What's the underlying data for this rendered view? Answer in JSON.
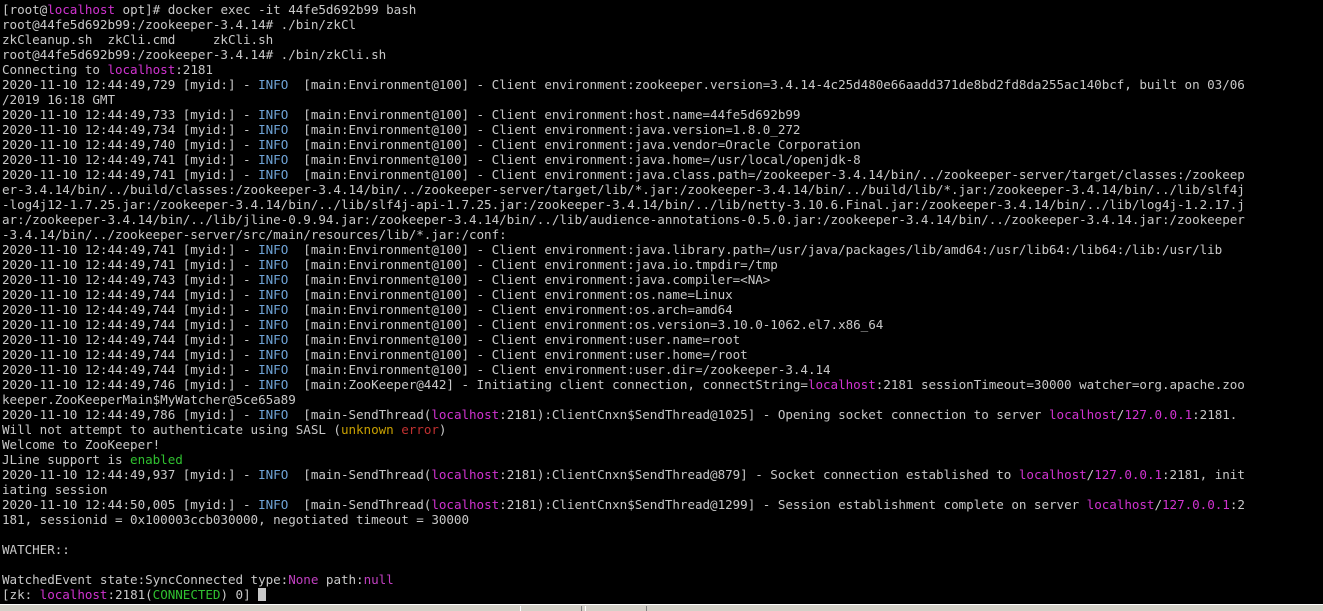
{
  "terminal": {
    "cursor_visible": true,
    "colors": {
      "background": "#000000",
      "text": "#c8c8c8",
      "info": "#6fa3d6",
      "host": "#d033d0",
      "ip": "#d033d0",
      "state": "#c040c0",
      "unknown": "#c8a000",
      "error": "#c03030",
      "ok": "#30c030"
    },
    "lines": [
      [
        {
          "t": "[root@",
          "c": "plain"
        },
        {
          "t": "localhost",
          "c": "host"
        },
        {
          "t": " opt]# docker exec -it 44fe5d692b99 bash",
          "c": "plain"
        }
      ],
      [
        {
          "t": "root@44fe5d692b99:/zookeeper-3.4.14# ./bin/zkCl",
          "c": "plain"
        }
      ],
      [
        {
          "t": "zkCleanup.sh  zkCli.cmd     zkCli.sh",
          "c": "plain"
        }
      ],
      [
        {
          "t": "root@44fe5d692b99:/zookeeper-3.4.14# ./bin/zkCli.sh",
          "c": "plain"
        }
      ],
      [
        {
          "t": "Connecting to ",
          "c": "plain"
        },
        {
          "t": "localhost",
          "c": "host"
        },
        {
          "t": ":2181",
          "c": "plain"
        }
      ],
      [
        {
          "t": "2020-11-10 12:44:49,729 [myid:] - ",
          "c": "plain"
        },
        {
          "t": "INFO",
          "c": "info"
        },
        {
          "t": "  [main:Environment@100] - Client environment:zookeeper.version=3.4.14-4c25d480e66aadd371de8bd2fd8da255ac140bcf, built on 03/06",
          "c": "plain"
        }
      ],
      [
        {
          "t": "/2019 16:18 GMT",
          "c": "plain"
        }
      ],
      [
        {
          "t": "2020-11-10 12:44:49,733 [myid:] - ",
          "c": "plain"
        },
        {
          "t": "INFO",
          "c": "info"
        },
        {
          "t": "  [main:Environment@100] - Client environment:host.name=44fe5d692b99",
          "c": "plain"
        }
      ],
      [
        {
          "t": "2020-11-10 12:44:49,734 [myid:] - ",
          "c": "plain"
        },
        {
          "t": "INFO",
          "c": "info"
        },
        {
          "t": "  [main:Environment@100] - Client environment:java.version=1.8.0_272",
          "c": "plain"
        }
      ],
      [
        {
          "t": "2020-11-10 12:44:49,740 [myid:] - ",
          "c": "plain"
        },
        {
          "t": "INFO",
          "c": "info"
        },
        {
          "t": "  [main:Environment@100] - Client environment:java.vendor=Oracle Corporation",
          "c": "plain"
        }
      ],
      [
        {
          "t": "2020-11-10 12:44:49,741 [myid:] - ",
          "c": "plain"
        },
        {
          "t": "INFO",
          "c": "info"
        },
        {
          "t": "  [main:Environment@100] - Client environment:java.home=/usr/local/openjdk-8",
          "c": "plain"
        }
      ],
      [
        {
          "t": "2020-11-10 12:44:49,741 [myid:] - ",
          "c": "plain"
        },
        {
          "t": "INFO",
          "c": "info"
        },
        {
          "t": "  [main:Environment@100] - Client environment:java.class.path=/zookeeper-3.4.14/bin/../zookeeper-server/target/classes:/zookeep",
          "c": "plain"
        }
      ],
      [
        {
          "t": "er-3.4.14/bin/../build/classes:/zookeeper-3.4.14/bin/../zookeeper-server/target/lib/*.jar:/zookeeper-3.4.14/bin/../build/lib/*.jar:/zookeeper-3.4.14/bin/../lib/slf4j",
          "c": "plain"
        }
      ],
      [
        {
          "t": "-log4j12-1.7.25.jar:/zookeeper-3.4.14/bin/../lib/slf4j-api-1.7.25.jar:/zookeeper-3.4.14/bin/../lib/netty-3.10.6.Final.jar:/zookeeper-3.4.14/bin/../lib/log4j-1.2.17.j",
          "c": "plain"
        }
      ],
      [
        {
          "t": "ar:/zookeeper-3.4.14/bin/../lib/jline-0.9.94.jar:/zookeeper-3.4.14/bin/../lib/audience-annotations-0.5.0.jar:/zookeeper-3.4.14/bin/../zookeeper-3.4.14.jar:/zookeeper",
          "c": "plain"
        }
      ],
      [
        {
          "t": "-3.4.14/bin/../zookeeper-server/src/main/resources/lib/*.jar:/conf:",
          "c": "plain"
        }
      ],
      [
        {
          "t": "2020-11-10 12:44:49,741 [myid:] - ",
          "c": "plain"
        },
        {
          "t": "INFO",
          "c": "info"
        },
        {
          "t": "  [main:Environment@100] - Client environment:java.library.path=/usr/java/packages/lib/amd64:/usr/lib64:/lib64:/lib:/usr/lib",
          "c": "plain"
        }
      ],
      [
        {
          "t": "2020-11-10 12:44:49,741 [myid:] - ",
          "c": "plain"
        },
        {
          "t": "INFO",
          "c": "info"
        },
        {
          "t": "  [main:Environment@100] - Client environment:java.io.tmpdir=/tmp",
          "c": "plain"
        }
      ],
      [
        {
          "t": "2020-11-10 12:44:49,743 [myid:] - ",
          "c": "plain"
        },
        {
          "t": "INFO",
          "c": "info"
        },
        {
          "t": "  [main:Environment@100] - Client environment:java.compiler=<NA>",
          "c": "plain"
        }
      ],
      [
        {
          "t": "2020-11-10 12:44:49,744 [myid:] - ",
          "c": "plain"
        },
        {
          "t": "INFO",
          "c": "info"
        },
        {
          "t": "  [main:Environment@100] - Client environment:os.name=Linux",
          "c": "plain"
        }
      ],
      [
        {
          "t": "2020-11-10 12:44:49,744 [myid:] - ",
          "c": "plain"
        },
        {
          "t": "INFO",
          "c": "info"
        },
        {
          "t": "  [main:Environment@100] - Client environment:os.arch=amd64",
          "c": "plain"
        }
      ],
      [
        {
          "t": "2020-11-10 12:44:49,744 [myid:] - ",
          "c": "plain"
        },
        {
          "t": "INFO",
          "c": "info"
        },
        {
          "t": "  [main:Environment@100] - Client environment:os.version=3.10.0-1062.el7.x86_64",
          "c": "plain"
        }
      ],
      [
        {
          "t": "2020-11-10 12:44:49,744 [myid:] - ",
          "c": "plain"
        },
        {
          "t": "INFO",
          "c": "info"
        },
        {
          "t": "  [main:Environment@100] - Client environment:user.name=root",
          "c": "plain"
        }
      ],
      [
        {
          "t": "2020-11-10 12:44:49,744 [myid:] - ",
          "c": "plain"
        },
        {
          "t": "INFO",
          "c": "info"
        },
        {
          "t": "  [main:Environment@100] - Client environment:user.home=/root",
          "c": "plain"
        }
      ],
      [
        {
          "t": "2020-11-10 12:44:49,744 [myid:] - ",
          "c": "plain"
        },
        {
          "t": "INFO",
          "c": "info"
        },
        {
          "t": "  [main:Environment@100] - Client environment:user.dir=/zookeeper-3.4.14",
          "c": "plain"
        }
      ],
      [
        {
          "t": "2020-11-10 12:44:49,746 [myid:] - ",
          "c": "plain"
        },
        {
          "t": "INFO",
          "c": "info"
        },
        {
          "t": "  [main:ZooKeeper@442] - Initiating client connection, connectString=",
          "c": "plain"
        },
        {
          "t": "localhost",
          "c": "host"
        },
        {
          "t": ":2181 sessionTimeout=30000 watcher=org.apache.zoo",
          "c": "plain"
        }
      ],
      [
        {
          "t": "keeper.ZooKeeperMain$MyWatcher@5ce65a89",
          "c": "plain"
        }
      ],
      [
        {
          "t": "2020-11-10 12:44:49,786 [myid:] - ",
          "c": "plain"
        },
        {
          "t": "INFO",
          "c": "info"
        },
        {
          "t": "  [main-SendThread(",
          "c": "plain"
        },
        {
          "t": "localhost",
          "c": "host"
        },
        {
          "t": ":2181):ClientCnxn$SendThread@1025] - Opening socket connection to server ",
          "c": "plain"
        },
        {
          "t": "localhost",
          "c": "host"
        },
        {
          "t": "/",
          "c": "plain"
        },
        {
          "t": "127.0.0.1",
          "c": "ip"
        },
        {
          "t": ":2181.",
          "c": "plain"
        }
      ],
      [
        {
          "t": "Will not attempt to authenticate using SASL (",
          "c": "plain"
        },
        {
          "t": "unknown",
          "c": "unknown"
        },
        {
          "t": " ",
          "c": "plain"
        },
        {
          "t": "error",
          "c": "error"
        },
        {
          "t": ")",
          "c": "plain"
        }
      ],
      [
        {
          "t": "Welcome to ZooKeeper!",
          "c": "plain"
        }
      ],
      [
        {
          "t": "JLine support is ",
          "c": "plain"
        },
        {
          "t": "enabled",
          "c": "ok"
        }
      ],
      [
        {
          "t": "2020-11-10 12:44:49,937 [myid:] - ",
          "c": "plain"
        },
        {
          "t": "INFO",
          "c": "info"
        },
        {
          "t": "  [main-SendThread(",
          "c": "plain"
        },
        {
          "t": "localhost",
          "c": "host"
        },
        {
          "t": ":2181):ClientCnxn$SendThread@879] - Socket connection established to ",
          "c": "plain"
        },
        {
          "t": "localhost",
          "c": "host"
        },
        {
          "t": "/",
          "c": "plain"
        },
        {
          "t": "127.0.0.1",
          "c": "ip"
        },
        {
          "t": ":2181, init",
          "c": "plain"
        }
      ],
      [
        {
          "t": "iating session",
          "c": "plain"
        }
      ],
      [
        {
          "t": "2020-11-10 12:44:50,005 [myid:] - ",
          "c": "plain"
        },
        {
          "t": "INFO",
          "c": "info"
        },
        {
          "t": "  [main-SendThread(",
          "c": "plain"
        },
        {
          "t": "localhost",
          "c": "host"
        },
        {
          "t": ":2181):ClientCnxn$SendThread@1299] - Session establishment complete on server ",
          "c": "plain"
        },
        {
          "t": "localhost",
          "c": "host"
        },
        {
          "t": "/",
          "c": "plain"
        },
        {
          "t": "127.0.0.1",
          "c": "ip"
        },
        {
          "t": ":2",
          "c": "plain"
        }
      ],
      [
        {
          "t": "181, sessionid = 0x100003ccb030000, negotiated timeout = 30000",
          "c": "plain"
        }
      ],
      [
        {
          "t": "",
          "c": "plain"
        }
      ],
      [
        {
          "t": "WATCHER::",
          "c": "plain"
        }
      ],
      [
        {
          "t": "",
          "c": "plain"
        }
      ],
      [
        {
          "t": "WatchedEvent state:SyncConnected type:",
          "c": "plain"
        },
        {
          "t": "None",
          "c": "state"
        },
        {
          "t": " path:",
          "c": "plain"
        },
        {
          "t": "null",
          "c": "state"
        }
      ],
      [
        {
          "t": "[zk: ",
          "c": "plain"
        },
        {
          "t": "localhost",
          "c": "host"
        },
        {
          "t": ":2181(",
          "c": "plain"
        },
        {
          "t": "CONNECTED",
          "c": "ok"
        },
        {
          "t": ") 0] ",
          "c": "plain"
        }
      ]
    ]
  }
}
